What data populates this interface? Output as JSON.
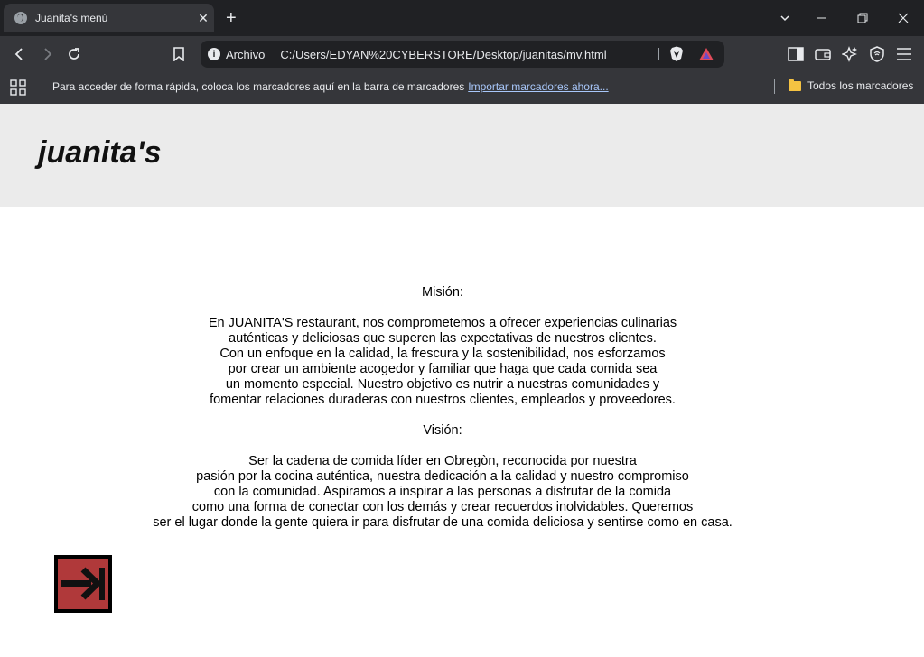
{
  "browser": {
    "tab": {
      "title": "Juanita's menú",
      "close": "✕"
    },
    "new_tab": "+",
    "window_controls": {
      "dropdown": "⌄",
      "minimize": "—",
      "restore": "❐",
      "close": "✕"
    },
    "address": {
      "scheme_label": "Archivo",
      "url": "C:/Users/EDYAN%20CYBERSTORE/Desktop/juanitas/mv.html"
    },
    "bookmarks_bar": {
      "prompt": "Para acceder de forma rápida, coloca los marcadores aquí en la barra de marcadores",
      "import_link": "Importar marcadores ahora...",
      "all_bookmarks": "Todos los marcadores"
    }
  },
  "page": {
    "logo": "juanita's",
    "mission": {
      "heading": "Misión:",
      "lines": [
        "En JUANITA'S restaurant, nos comprometemos a ofrecer experiencias culinarias",
        "auténticas y deliciosas que superen las expectativas de nuestros clientes.",
        "Con un enfoque en la calidad, la frescura y la sostenibilidad, nos esforzamos",
        "por crear un ambiente acogedor y familiar que haga que cada comida sea",
        "un momento especial. Nuestro objetivo es nutrir a nuestras comunidades y",
        "fomentar relaciones duraderas con nuestros clientes, empleados y proveedores."
      ]
    },
    "vision": {
      "heading": "Visión:",
      "lines": [
        "Ser la cadena de comida líder en Obregòn, reconocida por nuestra",
        "pasión por la cocina auténtica, nuestra dedicación a la calidad y nuestro compromiso",
        "con la comunidad. Aspiramos a inspirar a las personas a disfrutar de la comida",
        "como una forma de conectar con los demás y crear recuerdos inolvidables. Queremos",
        "ser el lugar donde la gente quiera ir para disfrutar de una comida deliciosa y sentirse como en casa."
      ]
    },
    "back_button_icon": "arrow-right-icon",
    "colors": {
      "header_bg": "#ebebeb",
      "button_red": "#b0393a"
    }
  }
}
